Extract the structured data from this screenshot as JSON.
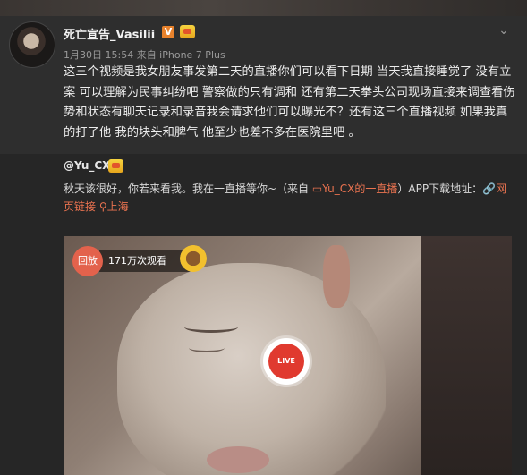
{
  "post": {
    "username": "死亡宣告_Vasilii",
    "verified_badge": "V",
    "meta": "1月30日 15:54 来自 iPhone 7 Plus",
    "text": "这三个视频是我女朋友事发第二天的直播你们可以看下日期 当天我直接睡觉了 没有立案 可以理解为民事纠纷吧 警察做的只有调和 还有第二天拳头公司现场直接来调查看伤势和状态有聊天记录和录音我会请求他们可以曝光不？还有这三个直播视频 如果我真的打了他 我的块头和脾气 他至少也差不多在医院里吧 。"
  },
  "repost": {
    "username": "@Yu_CX",
    "text_before": "秋天该很好，你若来看我。我在一直播等你~（来自 ",
    "link_source": "Yu_CX的一直播",
    "text_middle": "）APP下载地址：",
    "link_web": "网页链接",
    "location_icon": "location-pin-icon",
    "location": "上海"
  },
  "video": {
    "replay_label": "回放",
    "views": "171万次观看",
    "live_label": "LIVE"
  },
  "colors": {
    "accent": "#eb7350",
    "badge_orange": "#e8822c",
    "live_red": "#e03a2f"
  }
}
